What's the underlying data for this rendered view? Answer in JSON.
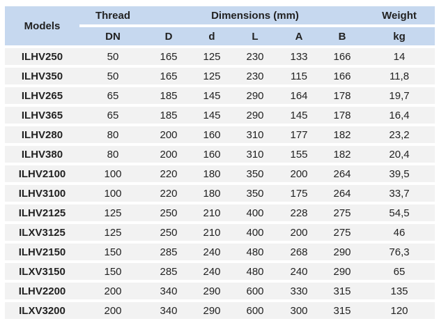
{
  "table": {
    "header_top": {
      "models": "Models",
      "thread": "Thread",
      "dimensions": "Dimensions (mm)",
      "weight": "Weight"
    },
    "header_sub": [
      "DN",
      "D",
      "d",
      "L",
      "A",
      "B",
      "kg"
    ],
    "rows": [
      [
        "ILHV250",
        "50",
        "165",
        "125",
        "230",
        "133",
        "166",
        "14"
      ],
      [
        "ILHV350",
        "50",
        "165",
        "125",
        "230",
        "115",
        "166",
        "11,8"
      ],
      [
        "ILHV265",
        "65",
        "185",
        "145",
        "290",
        "164",
        "178",
        "19,7"
      ],
      [
        "ILHV365",
        "65",
        "185",
        "145",
        "290",
        "145",
        "178",
        "16,4"
      ],
      [
        "ILHV280",
        "80",
        "200",
        "160",
        "310",
        "177",
        "182",
        "23,2"
      ],
      [
        "ILHV380",
        "80",
        "200",
        "160",
        "310",
        "155",
        "182",
        "20,4"
      ],
      [
        "ILHV2100",
        "100",
        "220",
        "180",
        "350",
        "200",
        "264",
        "39,5"
      ],
      [
        "ILHV3100",
        "100",
        "220",
        "180",
        "350",
        "175",
        "264",
        "33,7"
      ],
      [
        "ILHV2125",
        "125",
        "250",
        "210",
        "400",
        "228",
        "275",
        "54,5"
      ],
      [
        "ILXV3125",
        "125",
        "250",
        "210",
        "400",
        "200",
        "275",
        "46"
      ],
      [
        "ILHV2150",
        "150",
        "285",
        "240",
        "480",
        "268",
        "290",
        "76,3"
      ],
      [
        "ILXV3150",
        "150",
        "285",
        "240",
        "480",
        "240",
        "290",
        "65"
      ],
      [
        "ILHV2200",
        "200",
        "340",
        "290",
        "600",
        "330",
        "315",
        "135"
      ],
      [
        "ILXV3200",
        "200",
        "340",
        "290",
        "600",
        "300",
        "315",
        "120"
      ]
    ]
  },
  "colors": {
    "header_bg": "#c6d8ef",
    "row_bg": "#f2f2f2",
    "text": "#222222"
  }
}
